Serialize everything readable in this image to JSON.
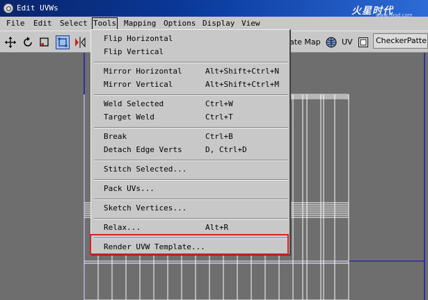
{
  "window": {
    "title": "Edit UVWs"
  },
  "watermark": {
    "brand": "火星时代",
    "url": "www.hxsd.com"
  },
  "menubar": {
    "items": [
      "File",
      "Edit",
      "Select",
      "Tools",
      "Mapping",
      "Options",
      "Display",
      "View"
    ]
  },
  "toolbar": {
    "map_label": "late Map",
    "uv_label": "UV",
    "checker_value": "CheckerPattern"
  },
  "tools_menu": {
    "items": [
      {
        "label": "Flip Horizontal",
        "shortcut": ""
      },
      {
        "label": "Flip Vertical",
        "shortcut": ""
      },
      {
        "label": "Mirror Horizontal",
        "shortcut": "Alt+Shift+Ctrl+N"
      },
      {
        "label": "Mirror Vertical",
        "shortcut": "Alt+Shift+Ctrl+M"
      },
      {
        "label": "Weld Selected",
        "shortcut": "Ctrl+W"
      },
      {
        "label": "Target Weld",
        "shortcut": "Ctrl+T"
      },
      {
        "label": "Break",
        "shortcut": "Ctrl+B"
      },
      {
        "label": "Detach Edge Verts",
        "shortcut": "D, Ctrl+D"
      },
      {
        "label": "Stitch Selected...",
        "shortcut": ""
      },
      {
        "label": "Pack UVs...",
        "shortcut": ""
      },
      {
        "label": "Sketch Vertices...",
        "shortcut": ""
      },
      {
        "label": "Relax...",
        "shortcut": "Alt+R"
      },
      {
        "label": "Render UVW Template...",
        "shortcut": ""
      }
    ]
  },
  "colors": {
    "titlebar": "#0a246a",
    "chrome": "#c8c8c8",
    "viewport": "#6e6e6e",
    "uv_lines": "#ffffff",
    "uv_border": "#1a1ab4",
    "highlight": "#d81f1f"
  }
}
